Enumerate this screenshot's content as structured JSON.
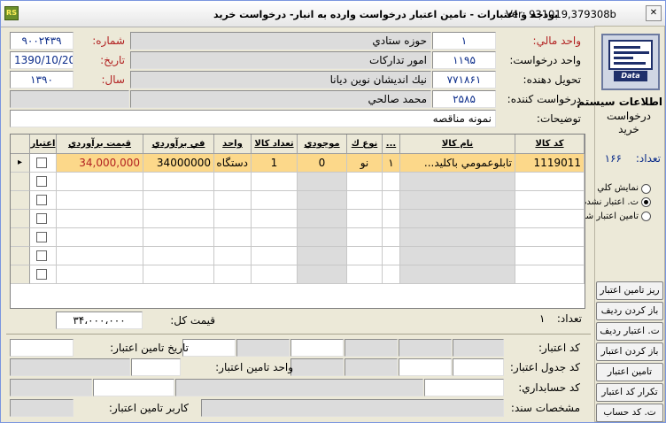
{
  "window": {
    "title": "بودجه و اعتبارات - تامين اعتبار درخواست وارده به انبار- درخواست خريد",
    "version": "Ver: 931019,379308b",
    "app_icon_text": "RS"
  },
  "header": {
    "number_label": "شماره:",
    "number_value": "۹۰۰۲۴۳۹",
    "date_label": "تاريخ:",
    "date_value": "1390/10/20",
    "year_label": "سال:",
    "year_value": "۱۳۹۰",
    "financial_unit_label": "واحد مالي:",
    "financial_unit_code": "۱",
    "financial_unit_name": "حوزه ستادي",
    "requesting_unit_label": "واحد درخواست:",
    "requesting_unit_code": "۱۱۹۵",
    "requesting_unit_name": "امور تداركات",
    "supplier_label": "تحويل دهنده:",
    "supplier_code": "۷۷۱۸۶۱",
    "supplier_name": "نيك انديشان نوين ديانا",
    "requester_label": "درخواست كننده:",
    "requester_code": "۲۵۸۵",
    "requester_name": "محمد صالحي",
    "description_label": "توضيحات:",
    "description_value": "نمونه مناقصه"
  },
  "side": {
    "logo_text": "Data",
    "system_info_title": "اطلاعات سيستم",
    "system_info_subtitle": "درخواست خريد",
    "count_label": "تعداد:",
    "count_value": "۱۶۶",
    "radio_options": [
      {
        "label": "نمايش كلي",
        "checked": false
      },
      {
        "label": "ت. اعتبار نشده",
        "checked": true
      },
      {
        "label": "تامين اعتبار شده",
        "checked": false
      }
    ],
    "buttons": [
      "ريز تامين اعتبار",
      "باز كردن رديف",
      "ت. اعتبار رديف",
      "باز كردن اعتبار",
      "تامين اعتبار",
      "تكرار كد اعتبار",
      "ت. كد حساب"
    ]
  },
  "grid": {
    "columns": [
      "كد كالا",
      "نام كالا",
      "...",
      "نوع ك",
      "موجودي",
      "تعداد كالا",
      "واحد",
      "في برآوردي",
      "قيمت برآوردي",
      "اعتبار"
    ],
    "rows": [
      {
        "code": "1119011",
        "name": "تابلوعمومي باكليد...",
        "dots": "۱",
        "type": "نو",
        "stock": "0",
        "qty": "1",
        "unit": "دستگاه",
        "unit_price": "34000000",
        "est_price": "34,000,000",
        "credit": false
      }
    ],
    "empty_rows": 6
  },
  "totals": {
    "count_label": "تعداد:",
    "count_value": "۱",
    "total_price_label": "قيمت كل:",
    "total_price_value": "۳۴،۰۰۰،۰۰۰"
  },
  "bottom": {
    "credit_code_label": "كد اعتبار:",
    "credit_table_code_label": "كد جدول اعتبار:",
    "account_code_label": "كد حسابداري:",
    "doc_specs_label": "مشخصات سند:",
    "credit_date_label": "تاريخ تامين اعتبار:",
    "credit_unit_label": "واحد تامين اعتبار:",
    "credit_user_label": "كاربر تامين اعتبار:"
  }
}
